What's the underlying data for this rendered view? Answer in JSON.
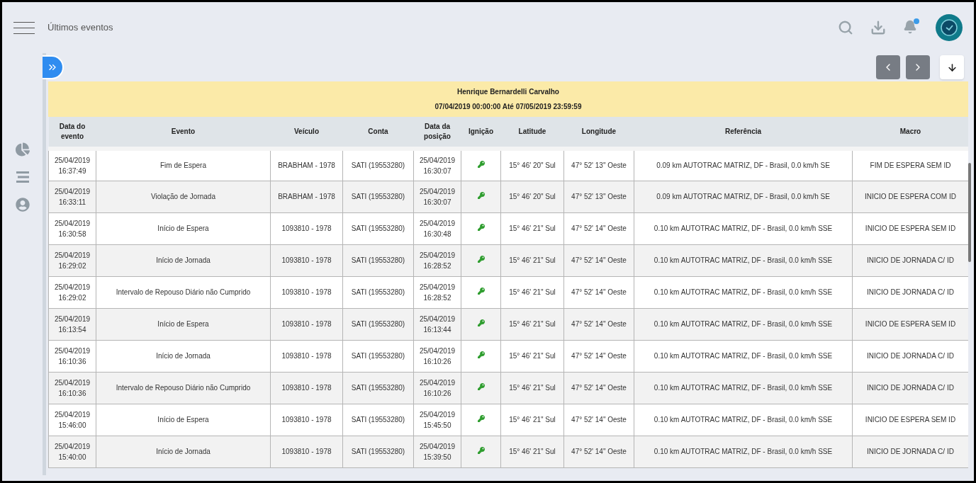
{
  "header": {
    "title": "Últimos eventos",
    "notification_dot": true
  },
  "report": {
    "name": "Henrique Bernardelli Carvalho",
    "period": "07/04/2019 00:00:00 Até 07/05/2019 23:59:59"
  },
  "table": {
    "columns": [
      "Data do evento",
      "Evento",
      "Veículo",
      "Conta",
      "Data da posição",
      "Ignição",
      "Latitude",
      "Longitude",
      "Referência",
      "Macro"
    ],
    "rows": [
      {
        "date": "25/04/2019 16:37:49",
        "event": "Fim de Espera",
        "vehicle": "BRABHAM - 1978",
        "account": "SATI (19553280)",
        "position_date": "25/04/2019 16:30:07",
        "ignition": true,
        "latitude": "15° 46' 20\" Sul",
        "longitude": "47° 52' 13\" Oeste",
        "reference": "0.09 km AUTOTRAC MATRIZ, DF - Brasil, 0.0 km/h SE",
        "macro": "FIM DE ESPERA SEM ID"
      },
      {
        "date": "25/04/2019 16:33:11",
        "event": "Violação de Jornada",
        "vehicle": "BRABHAM - 1978",
        "account": "SATI (19553280)",
        "position_date": "25/04/2019 16:30:07",
        "ignition": true,
        "latitude": "15° 46' 20\" Sul",
        "longitude": "47° 52' 13\" Oeste",
        "reference": "0.09 km AUTOTRAC MATRIZ, DF - Brasil, 0.0 km/h SE",
        "macro": "INICIO DE ESPERA COM ID"
      },
      {
        "date": "25/04/2019 16:30:58",
        "event": "Início de Espera",
        "vehicle": "1093810 - 1978",
        "account": "SATI (19553280)",
        "position_date": "25/04/2019 16:30:48",
        "ignition": true,
        "latitude": "15° 46' 21\" Sul",
        "longitude": "47° 52' 14\" Oeste",
        "reference": "0.10 km AUTOTRAC MATRIZ, DF - Brasil, 0.0 km/h SSE",
        "macro": "INICIO DE ESPERA SEM ID"
      },
      {
        "date": "25/04/2019 16:29:02",
        "event": "Início de Jornada",
        "vehicle": "1093810 - 1978",
        "account": "SATI (19553280)",
        "position_date": "25/04/2019 16:28:52",
        "ignition": true,
        "latitude": "15° 46' 21\" Sul",
        "longitude": "47° 52' 14\" Oeste",
        "reference": "0.10 km AUTOTRAC MATRIZ, DF - Brasil, 0.0 km/h SSE",
        "macro": "INICIO DE JORNADA C/ ID"
      },
      {
        "date": "25/04/2019 16:29:02",
        "event": "Intervalo de Repouso Diário não Cumprido",
        "vehicle": "1093810 - 1978",
        "account": "SATI (19553280)",
        "position_date": "25/04/2019 16:28:52",
        "ignition": true,
        "latitude": "15° 46' 21\" Sul",
        "longitude": "47° 52' 14\" Oeste",
        "reference": "0.10 km AUTOTRAC MATRIZ, DF - Brasil, 0.0 km/h SSE",
        "macro": "INICIO DE JORNADA C/ ID"
      },
      {
        "date": "25/04/2019 16:13:54",
        "event": "Início de Espera",
        "vehicle": "1093810 - 1978",
        "account": "SATI (19553280)",
        "position_date": "25/04/2019 16:13:44",
        "ignition": true,
        "latitude": "15° 46' 21\" Sul",
        "longitude": "47° 52' 14\" Oeste",
        "reference": "0.10 km AUTOTRAC MATRIZ, DF - Brasil, 0.0 km/h SSE",
        "macro": "INICIO DE ESPERA SEM ID"
      },
      {
        "date": "25/04/2019 16:10:36",
        "event": "Início de Jornada",
        "vehicle": "1093810 - 1978",
        "account": "SATI (19553280)",
        "position_date": "25/04/2019 16:10:26",
        "ignition": true,
        "latitude": "15° 46' 21\" Sul",
        "longitude": "47° 52' 14\" Oeste",
        "reference": "0.10 km AUTOTRAC MATRIZ, DF - Brasil, 0.0 km/h SSE",
        "macro": "INICIO DE JORNADA C/ ID"
      },
      {
        "date": "25/04/2019 16:10:36",
        "event": "Intervalo de Repouso Diário não Cumprido",
        "vehicle": "1093810 - 1978",
        "account": "SATI (19553280)",
        "position_date": "25/04/2019 16:10:26",
        "ignition": true,
        "latitude": "15° 46' 21\" Sul",
        "longitude": "47° 52' 14\" Oeste",
        "reference": "0.10 km AUTOTRAC MATRIZ, DF - Brasil, 0.0 km/h SSE",
        "macro": "INICIO DE JORNADA C/ ID"
      },
      {
        "date": "25/04/2019 15:46:00",
        "event": "Início de Espera",
        "vehicle": "1093810 - 1978",
        "account": "SATI (19553280)",
        "position_date": "25/04/2019 15:45:50",
        "ignition": true,
        "latitude": "15° 46' 21\" Sul",
        "longitude": "47° 52' 14\" Oeste",
        "reference": "0.10 km AUTOTRAC MATRIZ, DF - Brasil, 0.0 km/h SSE",
        "macro": "INICIO DE ESPERA SEM ID"
      },
      {
        "date": "25/04/2019 15:40:00",
        "event": "Início de Jornada",
        "vehicle": "1093810 - 1978",
        "account": "SATI (19553280)",
        "position_date": "25/04/2019 15:39:50",
        "ignition": true,
        "latitude": "15° 46' 21\" Sul",
        "longitude": "47° 52' 14\" Oeste",
        "reference": "0.10 km AUTOTRAC MATRIZ, DF - Brasil, 0.0 km/h SSE",
        "macro": "INICIO DE JORNADA C/ ID"
      }
    ]
  }
}
